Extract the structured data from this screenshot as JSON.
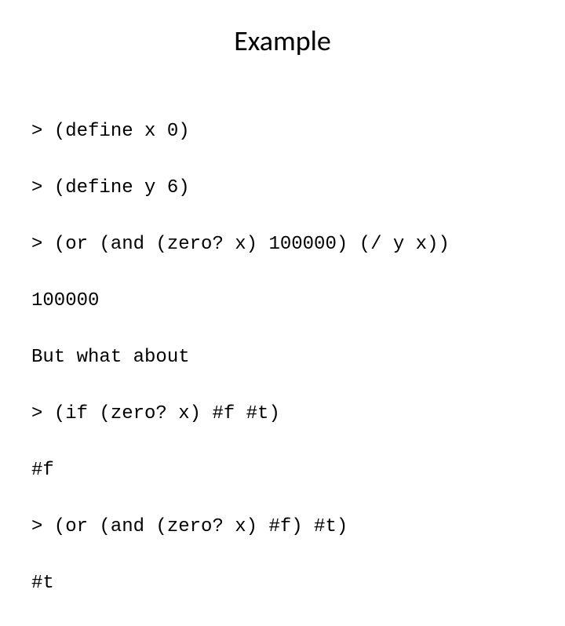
{
  "title": "Example",
  "code": {
    "line1": "> (define x 0)",
    "line2": "> (define y 6)",
    "line3": "> (or (and (zero? x) 100000) (/ y x))",
    "line4": "100000",
    "line5": "But what about",
    "line6": "> (if (zero? x) #f #t)",
    "line7": "#f",
    "line8": "> (or (and (zero? x) #f) #t)",
    "line9": "#t"
  }
}
